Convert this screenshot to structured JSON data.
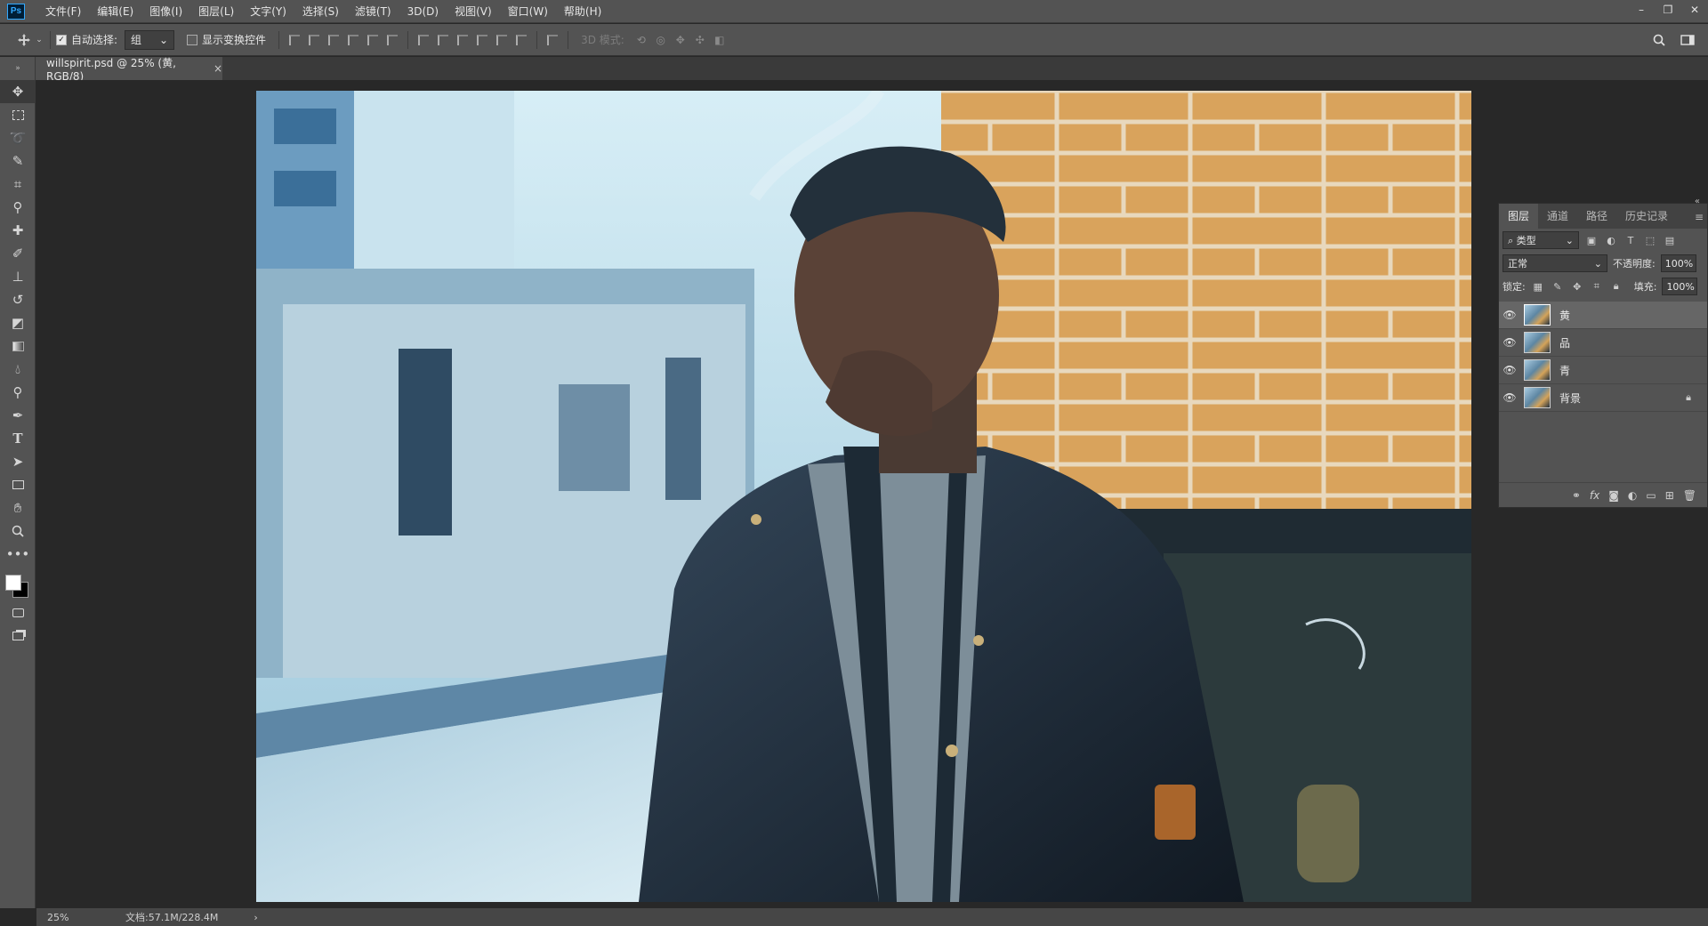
{
  "menubar": {
    "logo": "Ps",
    "items": [
      "文件(F)",
      "编辑(E)",
      "图像(I)",
      "图层(L)",
      "文字(Y)",
      "选择(S)",
      "滤镜(T)",
      "3D(D)",
      "视图(V)",
      "窗口(W)",
      "帮助(H)"
    ],
    "window_controls": [
      "–",
      "❐",
      "✕"
    ]
  },
  "options": {
    "auto_select_label": "自动选择:",
    "auto_select_checked": true,
    "auto_select_value": "组",
    "show_transform_label": "显示变换控件",
    "show_transform_checked": false,
    "mode3d_label": "3D 模式:"
  },
  "document_tab": {
    "title": "willspirit.psd @ 25% (黄, RGB/8)",
    "close": "×"
  },
  "status": {
    "zoom": "25%",
    "doc_size": "文档:57.1M/228.4M",
    "arrow": "›"
  },
  "layers_panel": {
    "tabs": [
      "图层",
      "通道",
      "路径",
      "历史记录"
    ],
    "active_tab": "图层",
    "filter_label": "类型",
    "blend_mode": "正常",
    "opacity_label": "不透明度:",
    "opacity_value": "100%",
    "lock_label": "锁定:",
    "fill_label": "填充:",
    "fill_value": "100%",
    "layers": [
      {
        "name": "黄",
        "active": true,
        "locked": false
      },
      {
        "name": "品",
        "active": false,
        "locked": false
      },
      {
        "name": "青",
        "active": false,
        "locked": false
      },
      {
        "name": "背景",
        "active": false,
        "locked": true
      }
    ]
  },
  "colors": {
    "foreground": "#ffffff",
    "background": "#000000"
  }
}
